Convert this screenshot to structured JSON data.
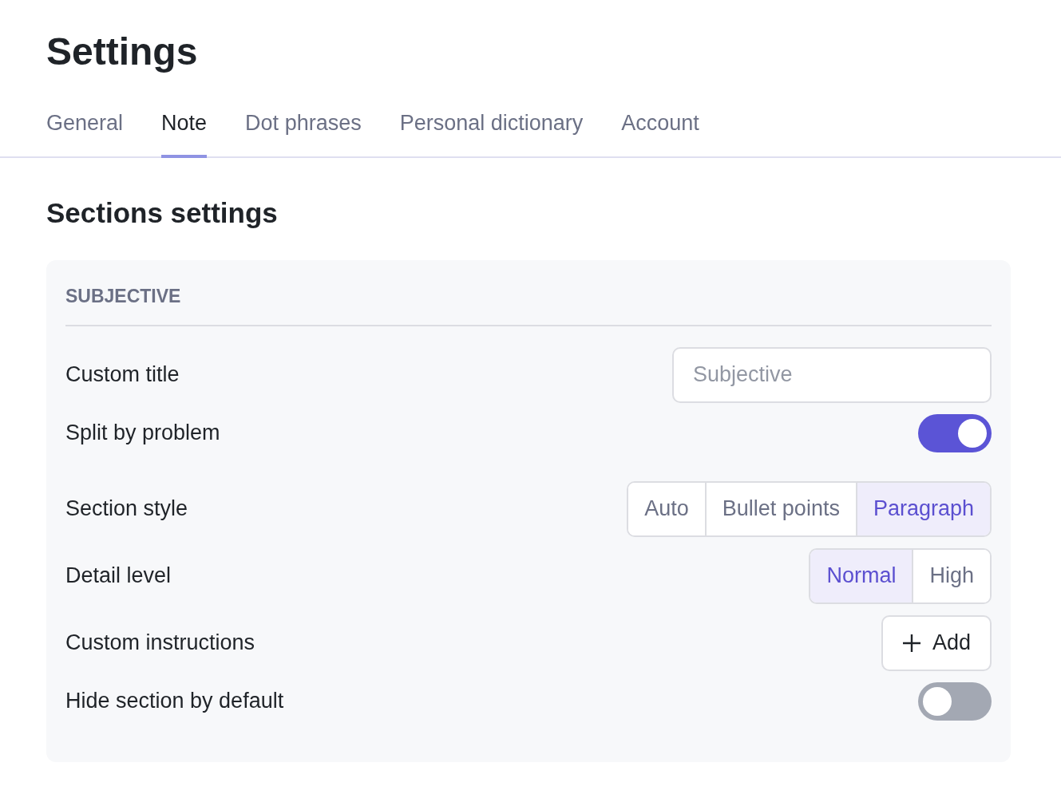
{
  "title": "Settings",
  "tabs": [
    {
      "label": "General",
      "selected": false
    },
    {
      "label": "Note",
      "selected": true
    },
    {
      "label": "Dot phrases",
      "selected": false
    },
    {
      "label": "Personal dictionary",
      "selected": false
    },
    {
      "label": "Account",
      "selected": false
    }
  ],
  "section_heading": "Sections settings",
  "section": {
    "name": "SUBJECTIVE",
    "rows": [
      {
        "kind": "text",
        "label": "Custom title",
        "placeholder": "Subjective"
      },
      {
        "kind": "toggle",
        "label": "Split by problem",
        "on": true
      },
      {
        "kind": "segmented",
        "label": "Section style",
        "options": [
          {
            "label": "Auto",
            "selected": false
          },
          {
            "label": "Bullet points",
            "selected": false
          },
          {
            "label": "Paragraph",
            "selected": true
          }
        ]
      },
      {
        "kind": "segmented",
        "label": "Detail level",
        "options": [
          {
            "label": "Normal",
            "selected": true
          },
          {
            "label": "High",
            "selected": false
          }
        ]
      },
      {
        "kind": "button",
        "label": "Custom instructions",
        "button": "Add"
      },
      {
        "kind": "toggle",
        "label": "Hide section by default",
        "on": false
      }
    ]
  }
}
